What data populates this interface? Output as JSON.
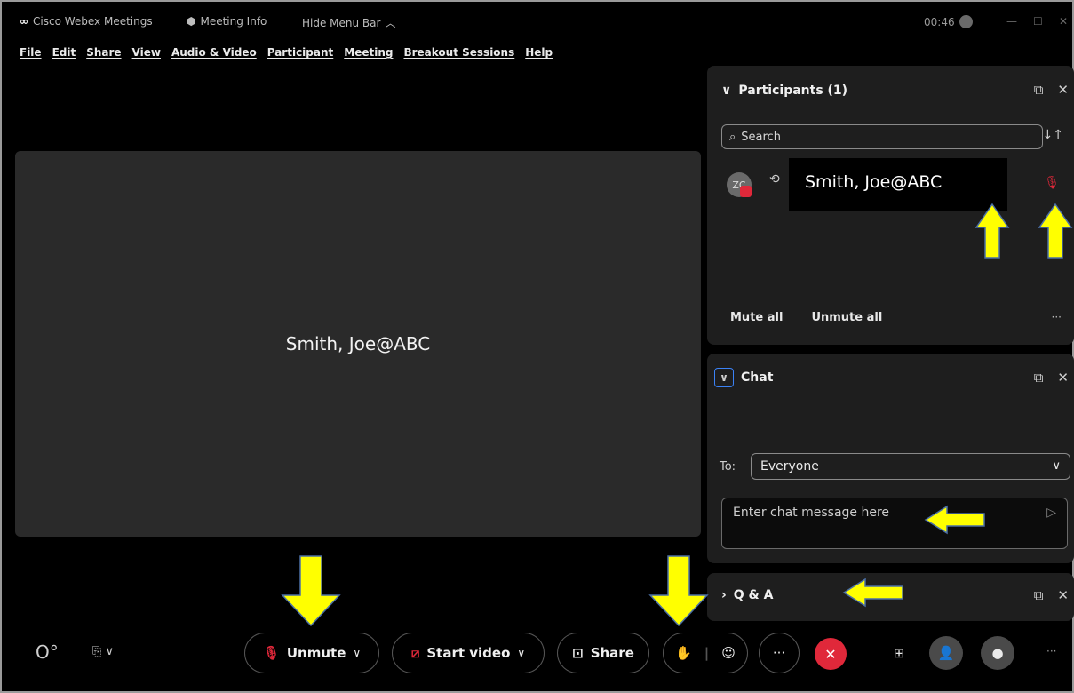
{
  "titlebar": {
    "app_name": "Cisco Webex Meetings",
    "meeting_info": "Meeting Info",
    "hide_menu_bar": "Hide Menu Bar",
    "timer": "00:46"
  },
  "menu": [
    "File",
    "Edit",
    "Share",
    "View",
    "Audio & Video",
    "Participant",
    "Meeting",
    "Breakout Sessions",
    "Help"
  ],
  "stage": {
    "name": "Smith, Joe@ABC"
  },
  "participants": {
    "title": "Participants (1)",
    "search_placeholder": "Search",
    "avatar_initials": "ZC",
    "item_name": "Smith, Joe@ABC",
    "mute_all": "Mute all",
    "unmute_all": "Unmute all",
    "more": "···"
  },
  "chat": {
    "title": "Chat",
    "to_label": "To:",
    "to_value": "Everyone",
    "message_placeholder": "Enter chat message here"
  },
  "qa": {
    "title": "Q & A"
  },
  "bottom": {
    "unmute": "Unmute",
    "start_video": "Start video",
    "share": "Share",
    "more": "···"
  },
  "colors": {
    "accent_red": "#e0283a",
    "arrow_yellow": "#ffff00",
    "panel_bg": "#1e1e1e"
  }
}
